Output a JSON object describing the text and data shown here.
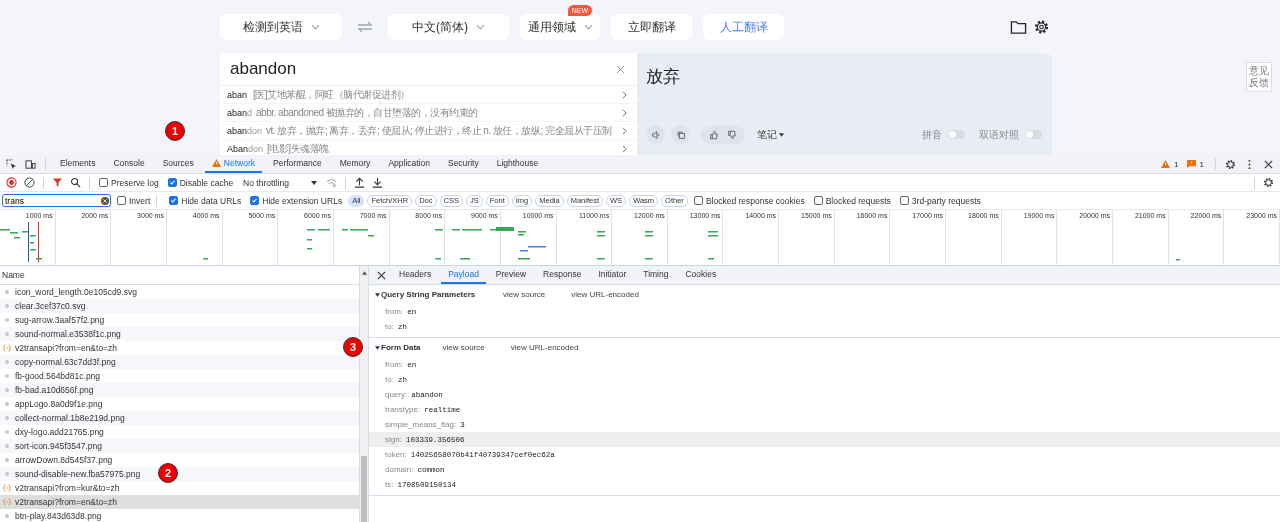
{
  "translator": {
    "source_language": "检测到英语",
    "target_language": "中文(简体)",
    "domain": {
      "label": "通用领域",
      "badge": "NEW"
    },
    "buttons": [
      {
        "label": "立即翻译",
        "highlighted": false
      },
      {
        "label": "人工翻译",
        "highlighted": true
      }
    ],
    "input": {
      "value": "abandon"
    },
    "suggestions": [
      {
        "prefix": "aban",
        "meaning": "[医]艾地苯醌，阿旺（脑代谢促进剂）"
      },
      {
        "prefix": "aban",
        "suffix": "d",
        "meaning": "abbr. abandoned 被抛弃的，自甘堕落的，没有约束的"
      },
      {
        "prefix": "aban",
        "suffix": "don",
        "meaning": "vt. 放弃，抛弃; 离弃，丢弃; 使屈从; 停止进行，终止 n. 放任，放纵; 完全屈从于压制"
      },
      {
        "prefix": "Aban",
        "suffix": "don",
        "meaning": "[电影]失魂落魄"
      }
    ],
    "output": {
      "text": "放弃",
      "notes_label": "笔记",
      "toggles": [
        {
          "label": "拼音",
          "on": false
        },
        {
          "label": "双语对照",
          "on": false
        }
      ]
    },
    "feedback": "意见反馈"
  },
  "devtools": {
    "tabs": [
      {
        "label": "Elements",
        "selected": false,
        "warning": false
      },
      {
        "label": "Console",
        "selected": false,
        "warning": false
      },
      {
        "label": "Sources",
        "selected": false,
        "warning": false
      },
      {
        "label": "Network",
        "selected": true,
        "warning": true
      },
      {
        "label": "Performance",
        "selected": false,
        "warning": false
      },
      {
        "label": "Memory",
        "selected": false,
        "warning": false
      },
      {
        "label": "Application",
        "selected": false,
        "warning": false
      },
      {
        "label": "Security",
        "selected": false,
        "warning": false
      },
      {
        "label": "Lighthouse",
        "selected": false,
        "warning": false
      }
    ],
    "issues": {
      "warnings": "1",
      "messages": "1"
    },
    "toolbar": {
      "checkboxes": [
        {
          "label": "Preserve log",
          "checked": false
        },
        {
          "label": "Disable cache",
          "checked": true
        }
      ],
      "throttling": "No throttling"
    },
    "filter": {
      "value": "trans",
      "options_before": [
        {
          "label": "Invert",
          "checked": false
        },
        {
          "label": "Hide data URLs",
          "checked": true
        },
        {
          "label": "Hide extension URLs",
          "checked": true
        }
      ],
      "types": [
        {
          "label": "All",
          "selected": true
        },
        {
          "label": "Fetch/XHR",
          "selected": false
        },
        {
          "label": "Doc",
          "selected": false
        },
        {
          "label": "CSS",
          "selected": false
        },
        {
          "label": "JS",
          "selected": false
        },
        {
          "label": "Font",
          "selected": false
        },
        {
          "label": "Img",
          "selected": false
        },
        {
          "label": "Media",
          "selected": false
        },
        {
          "label": "Manifest",
          "selected": false
        },
        {
          "label": "WS",
          "selected": false
        },
        {
          "label": "Wasm",
          "selected": false
        },
        {
          "label": "Other",
          "selected": false
        }
      ],
      "options_after": [
        {
          "label": "Blocked response cookies",
          "checked": false
        },
        {
          "label": "Blocked requests",
          "checked": false
        },
        {
          "label": "3rd-party requests",
          "checked": false
        }
      ]
    },
    "overview": {
      "ticks": [
        "1000 ms",
        "2000 ms",
        "3000 ms",
        "4000 ms",
        "5000 ms",
        "6000 ms",
        "7000 ms",
        "8000 ms",
        "9000 ms",
        "10000 ms",
        "11000 ms",
        "12000 ms",
        "13000 ms",
        "14000 ms",
        "15000 ms",
        "16000 ms",
        "17000 ms",
        "18000 ms",
        "19000 ms",
        "20000 ms",
        "21000 ms",
        "22000 ms",
        "23000 ms"
      ]
    },
    "requests": {
      "column": "Name",
      "rows": [
        {
          "name": "icon_word_length.0e105cd9.svg",
          "kind": "image",
          "selected": false
        },
        {
          "name": "clear.3cef37c0.svg",
          "kind": "image",
          "selected": false
        },
        {
          "name": "sug-arrow.3aaf57f2.png",
          "kind": "image",
          "selected": false
        },
        {
          "name": "sound-normal.e3538f1c.png",
          "kind": "image",
          "selected": false
        },
        {
          "name": "v2transapi?from=en&to=zh",
          "kind": "fetch",
          "selected": false
        },
        {
          "name": "copy-normal.63c7dd3f.png",
          "kind": "image",
          "selected": false
        },
        {
          "name": "fb-good.564bd81c.png",
          "kind": "image",
          "selected": false
        },
        {
          "name": "fb-bad.a10d656f.png",
          "kind": "image",
          "selected": false
        },
        {
          "name": "appLogo.8a0d9f1e.png",
          "kind": "image",
          "selected": false
        },
        {
          "name": "collect-normal.1b8e219d.png",
          "kind": "image",
          "selected": false
        },
        {
          "name": "dxy-logo.add21765.png",
          "kind": "image",
          "selected": false
        },
        {
          "name": "sort-icon.945f3547.png",
          "kind": "image",
          "selected": false
        },
        {
          "name": "arrowDown.8d545f37.png",
          "kind": "image",
          "selected": false
        },
        {
          "name": "sound-disable-new.fba57975.png",
          "kind": "image",
          "selected": false
        },
        {
          "name": "v2transapi?from=kur&to=zh",
          "kind": "fetch",
          "selected": false
        },
        {
          "name": "v2transapi?from=en&to=zh",
          "kind": "fetch",
          "selected": true
        },
        {
          "name": "btn-play.843d63d8.png",
          "kind": "image",
          "selected": false
        }
      ]
    },
    "details": {
      "tabs": [
        {
          "label": "Headers",
          "selected": false
        },
        {
          "label": "Payload",
          "selected": true
        },
        {
          "label": "Preview",
          "selected": false
        },
        {
          "label": "Response",
          "selected": false
        },
        {
          "label": "Initiator",
          "selected": false
        },
        {
          "label": "Timing",
          "selected": false
        },
        {
          "label": "Cookies",
          "selected": false
        }
      ],
      "sections": [
        {
          "title": "Query String Parameters",
          "links": [
            "view source",
            "view URL-encoded"
          ],
          "params": [
            {
              "key": "from:",
              "value": "en",
              "selected": false
            },
            {
              "key": "to:",
              "value": "zh",
              "selected": false
            }
          ]
        },
        {
          "title": "Form Data",
          "links": [
            "view source",
            "view URL-encoded"
          ],
          "params": [
            {
              "key": "from:",
              "value": "en",
              "selected": false
            },
            {
              "key": "to:",
              "value": "zh",
              "selected": false
            },
            {
              "key": "query:",
              "value": "abandon",
              "selected": false
            },
            {
              "key": "transtype:",
              "value": "realtime",
              "selected": false
            },
            {
              "key": "simple_means_flag:",
              "value": "3",
              "selected": false
            },
            {
              "key": "sign:",
              "value": "103339.356506",
              "selected": true
            },
            {
              "key": "token:",
              "value": "14025658070b41f40739347cef0ec62a",
              "selected": false
            },
            {
              "key": "domain:",
              "value": "common",
              "selected": false
            },
            {
              "key": "ts:",
              "value": "1708509150134",
              "selected": false
            }
          ]
        }
      ]
    }
  },
  "annotations": [
    {
      "label": "1"
    },
    {
      "label": "2"
    },
    {
      "label": "3"
    }
  ]
}
